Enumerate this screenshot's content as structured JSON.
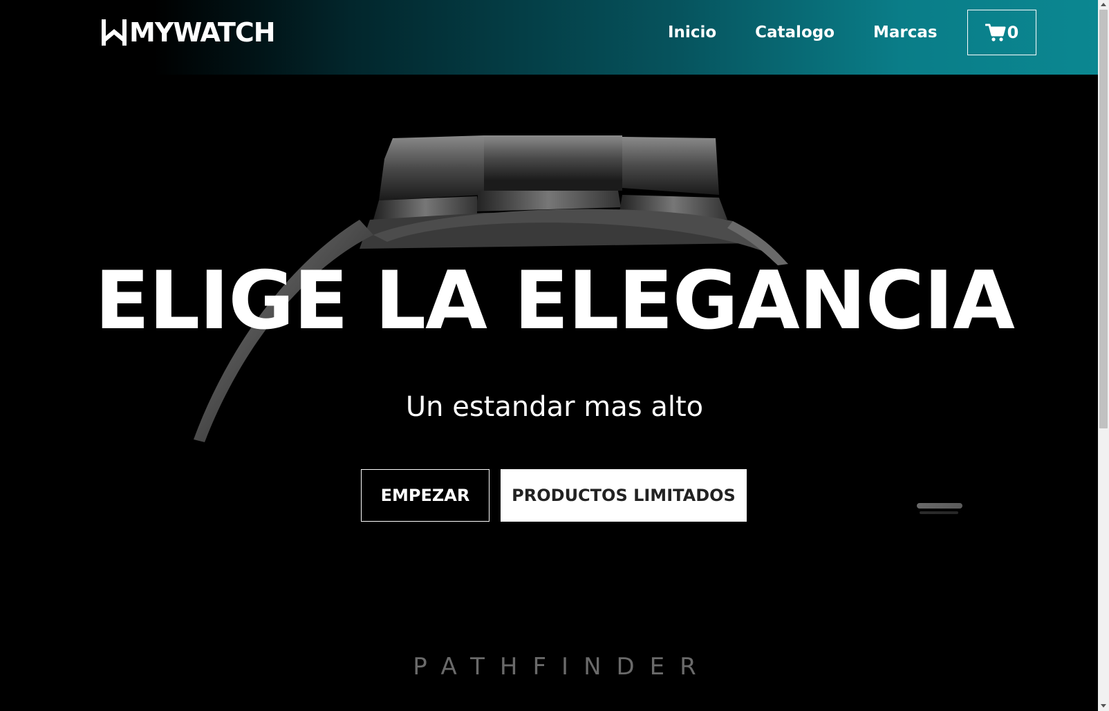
{
  "brand": {
    "name": "MYWATCH",
    "logo_icon": "w-monogram-icon"
  },
  "nav": {
    "items": [
      {
        "label": "Inicio"
      },
      {
        "label": "Catalogo"
      },
      {
        "label": "Marcas"
      }
    ],
    "cart": {
      "icon": "cart-icon",
      "count": "0"
    }
  },
  "hero": {
    "title": "ELIGE LA ELEGANCIA",
    "subtitle": "Un estandar mas alto",
    "primary_button": "EMPEZAR",
    "secondary_button": "PRODUCTOS LIMITADOS",
    "engraving": "PATHFINDER",
    "background": "watch-bracelet-closeup-image"
  },
  "colors": {
    "nav_gradient_start": "#000000",
    "nav_gradient_end": "#0b8791",
    "text": "#ffffff",
    "engraving": "#6a6a6a"
  }
}
